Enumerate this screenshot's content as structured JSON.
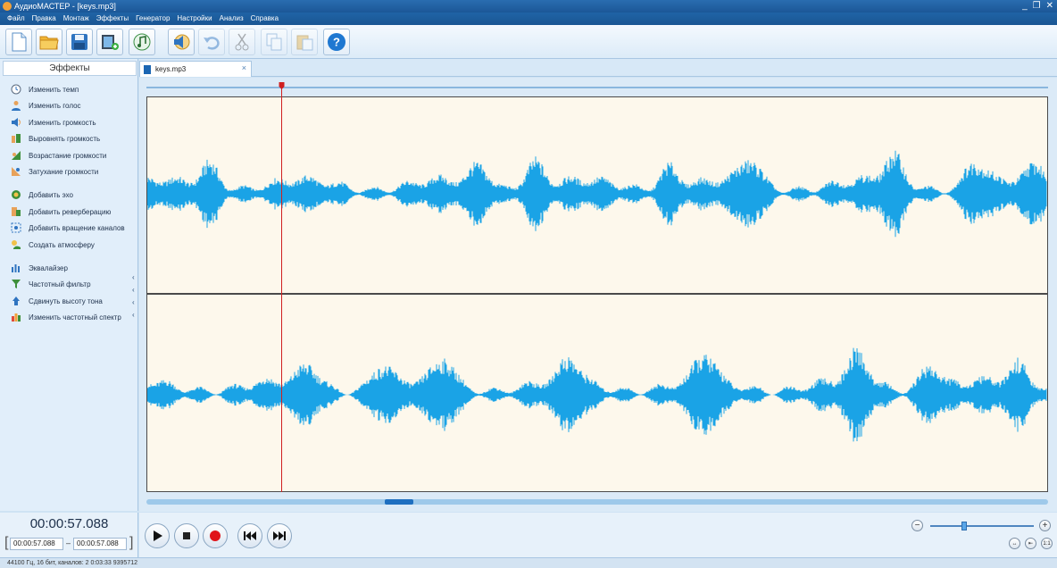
{
  "window": {
    "title": "АудиоМАСТЕР - [keys.mp3]",
    "controls": [
      "_",
      "❐",
      "✕"
    ]
  },
  "menu": [
    "Файл",
    "Правка",
    "Монтаж",
    "Эффекты",
    "Генератор",
    "Настройки",
    "Анализ",
    "Справка"
  ],
  "toolbar": {
    "icons": [
      "new-file-icon",
      "open-folder-icon",
      "save-icon",
      "add-video-icon",
      "add-audio-icon",
      "effects-icon",
      "undo-icon",
      "cut-icon",
      "copy-icon",
      "paste-icon",
      "help-icon"
    ],
    "help_label": "?"
  },
  "effects_panel": {
    "title": "Эффекты",
    "items": [
      {
        "label": "Изменить темп",
        "icon": "clock-icon"
      },
      {
        "label": "Изменить голос",
        "icon": "person-icon"
      },
      {
        "label": "Изменить громкость",
        "icon": "speaker-icon"
      },
      {
        "label": "Выровнять громкость",
        "icon": "level-icon"
      },
      {
        "label": "Возрастание громкости",
        "icon": "fade-in-icon"
      },
      {
        "label": "Затухание громкости",
        "icon": "fade-out-icon"
      },
      {
        "label": "Добавить эхо",
        "icon": "echo-icon"
      },
      {
        "label": "Добавить реверберацию",
        "icon": "reverb-icon"
      },
      {
        "label": "Добавить вращение каналов",
        "icon": "rotate-icon"
      },
      {
        "label": "Создать атмосферу",
        "icon": "atmosphere-icon"
      },
      {
        "label": "Эквалайзер",
        "icon": "equalizer-icon"
      },
      {
        "label": "Частотный фильтр",
        "icon": "filter-icon"
      },
      {
        "label": "Сдвинуть высоту тона",
        "icon": "pitch-icon"
      },
      {
        "label": "Изменить частотный спектр",
        "icon": "spectrum-icon"
      }
    ],
    "collapse_mark": "‹"
  },
  "file_tab": {
    "name": "keys.mp3",
    "close": "×"
  },
  "colors": {
    "waveform": "#1aa3e6",
    "playhead": "#d02020",
    "wave_background": "#fdf8ec"
  },
  "playback": {
    "position_fraction": 0.15,
    "current_time": "00:00:57.088",
    "selection_start": "00:00:57.088",
    "selection_end": "00:00:57.088",
    "range_sep": "–",
    "bracket_open": "[",
    "bracket_close": "]"
  },
  "zoom": {
    "minus": "−",
    "plus": "+",
    "fit": "↔",
    "fit_selection": "⇤",
    "one_to_one": "1:1",
    "level_fraction": 0.33
  },
  "scroll": {
    "thumb_fraction": 0.28
  },
  "status": {
    "info": "44100 Гц, 16 бит, каналов: 2   0:03:33 9395712"
  }
}
